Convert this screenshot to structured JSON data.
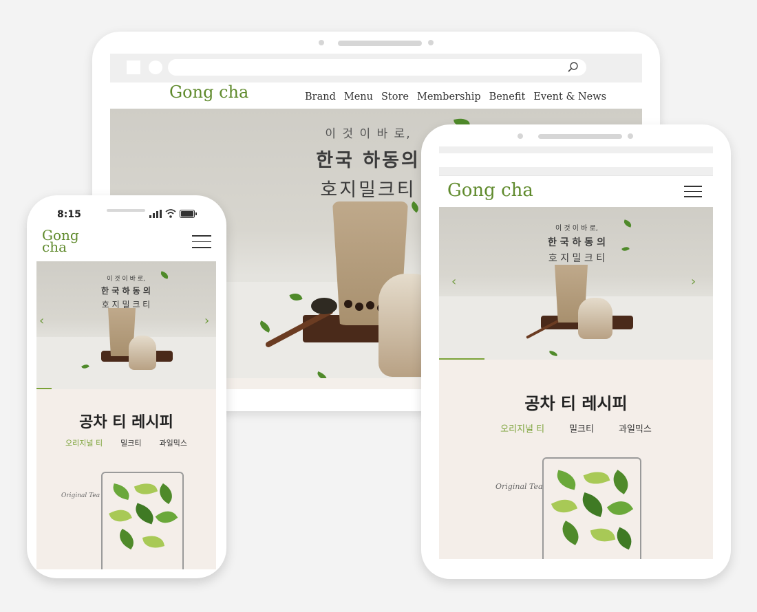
{
  "brand": {
    "name": "Gong cha",
    "name_line1": "Gong",
    "name_line2": "cha",
    "accent_color": "#5f8a2c"
  },
  "tablet": {
    "nav": [
      "Brand",
      "Menu",
      "Store",
      "Membership",
      "Benefit",
      "Event & News"
    ],
    "search_icon": "search-icon",
    "headline": [
      "이 것 이  바 로,",
      "한국 하동의",
      "호지밀크티"
    ]
  },
  "phone_right": {
    "headline": [
      "이 것 이  바 로,",
      "한 국  하 동 의",
      "호 지 밀 크 티"
    ],
    "section_title": "공차 티 레시피",
    "tabs": [
      "오리지널 티",
      "밀크티",
      "과일믹스"
    ],
    "caption": "Original Tea"
  },
  "phone_left": {
    "time": "8:15",
    "headline": [
      "이 것 이  바 로,",
      "한 국  하 동 의",
      "호 지 밀 크 티"
    ],
    "section_title": "공차 티 레시피",
    "tabs": [
      "오리지널 티",
      "밀크티",
      "과일믹스"
    ],
    "caption": "Original Tea"
  }
}
